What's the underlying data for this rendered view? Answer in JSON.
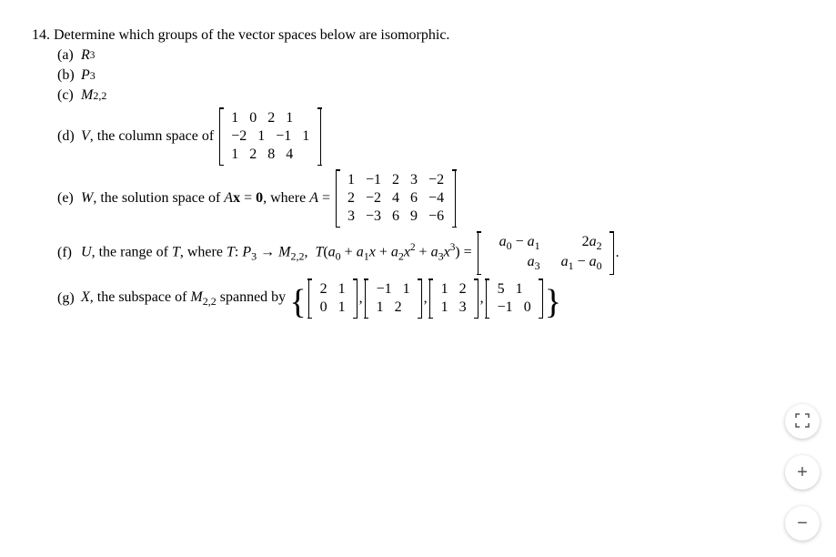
{
  "question": {
    "number": "14.",
    "prompt": "Determine which groups of the vector spaces below are isomorphic."
  },
  "parts": {
    "a": {
      "label": "(a)",
      "text_html": "R",
      "sup": "3"
    },
    "b": {
      "label": "(b)",
      "text_html": "P",
      "sub": "3"
    },
    "c": {
      "label": "(c)",
      "text_html": "M",
      "sub": "2,2"
    },
    "d": {
      "label": "(d)",
      "prefix": "V, the column space of ",
      "matrix": [
        [
          "1",
          "0",
          "2",
          "1"
        ],
        [
          "−2",
          "1",
          "−1",
          "1"
        ],
        [
          "1",
          "2",
          "8",
          "4"
        ]
      ]
    },
    "e": {
      "label": "(e)",
      "prefix": "W, the solution space of Ax = 0, where A = ",
      "matrix": [
        [
          "1",
          "−1",
          "2",
          "3",
          "−2"
        ],
        [
          "2",
          "−2",
          "4",
          "6",
          "−4"
        ],
        [
          "3",
          "−3",
          "6",
          "9",
          "−6"
        ]
      ]
    },
    "f": {
      "label": "(f)",
      "prefix_1": "U, the range of T, where T: P",
      "prefix_sub1": "3",
      "prefix_2": " → M",
      "prefix_sub2": "2,2",
      "prefix_3": ",  T(a",
      "t_expr": "a₀ + a₁x + a₂x² + a₃x³",
      "eq": ") = ",
      "matrix": [
        [
          "a₀ − a₁",
          "2a₂"
        ],
        [
          "a₃",
          "a₁ − a₀"
        ]
      ],
      "suffix": "."
    },
    "g": {
      "label": "(g)",
      "prefix": "X, the subspace of M",
      "prefix_sub": "2,2",
      "prefix_2": " spanned by ",
      "matrices": [
        [
          [
            "2",
            "1"
          ],
          [
            "0",
            "1"
          ]
        ],
        [
          [
            "−1",
            "1"
          ],
          [
            "1",
            "2"
          ]
        ],
        [
          [
            "1",
            "2"
          ],
          [
            "1",
            "3"
          ]
        ],
        [
          [
            "5",
            "1"
          ],
          [
            "−1",
            "0"
          ]
        ]
      ]
    }
  },
  "controls": {
    "fullscreen": "⛶",
    "zoom_in": "+",
    "zoom_out": "−"
  }
}
